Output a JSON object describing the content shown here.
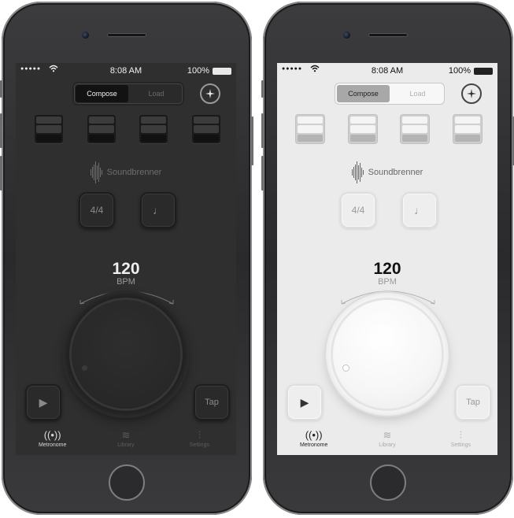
{
  "status": {
    "signal_dots": "●●●●●",
    "wifi_icon": "wifi-icon",
    "time": "8:08 AM",
    "battery": "100%"
  },
  "segmented": {
    "compose": "Compose",
    "load": "Load"
  },
  "compass_icon": "compass-icon",
  "beats": [
    "accent",
    "normal",
    "normal",
    "normal"
  ],
  "brand": {
    "name": "Soundbrenner"
  },
  "controls": {
    "time_signature": "4/4",
    "note_value": "♩",
    "tap": "Tap",
    "play_icon": "play-icon"
  },
  "tempo": {
    "value": "120",
    "unit": "BPM"
  },
  "tabs": [
    {
      "label": "Metronome",
      "icon": "radio-waves-icon",
      "active": true
    },
    {
      "label": "Library",
      "icon": "layers-icon",
      "active": false
    },
    {
      "label": "Settings",
      "icon": "sliders-icon",
      "active": false
    }
  ],
  "themes": {
    "dark_accent": "#2f2f30",
    "light_accent": "#ebebeb"
  }
}
